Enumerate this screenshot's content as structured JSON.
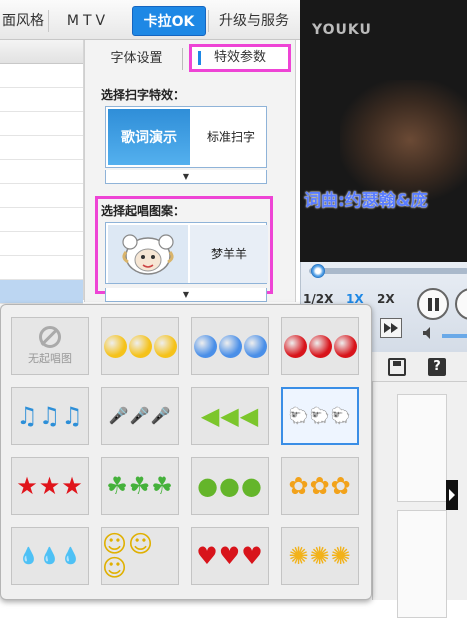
{
  "tabs": [
    {
      "label": "面风格"
    },
    {
      "label": "MTV"
    },
    {
      "label": "卡拉OK",
      "active": true
    },
    {
      "label": "升级与服务"
    }
  ],
  "settings": {
    "subtabs": [
      {
        "label": "字体设置"
      },
      {
        "label": "特效参数",
        "active": true
      }
    ],
    "scroll_effect_title": "选择扫字特效：",
    "scroll_effect_thumb": "歌词演示",
    "scroll_effect_value": "标准扫字",
    "start_pattern_title": "选择起唱图案：",
    "start_pattern_value": "梦羊羊"
  },
  "video": {
    "logo": "YOUKU",
    "lyric": "词曲:约瑟翰&庞"
  },
  "player": {
    "speeds": [
      "1/2X",
      "1X",
      "2X"
    ],
    "active_speed": "1X"
  },
  "pattern_grid": {
    "none_label": "无起唱图",
    "selected_index": 7,
    "items": [
      {
        "name": "none"
      },
      {
        "name": "yellow-dots",
        "color": "#f5c21a"
      },
      {
        "name": "blue-dots",
        "color": "#4a8fe8"
      },
      {
        "name": "red-dots",
        "color": "#d8141b"
      },
      {
        "name": "music-notes",
        "glyph": "♫♫♫",
        "color": "#2d8fd8"
      },
      {
        "name": "microphones",
        "glyph": "🎤🎤🎤",
        "color": "#f5c21a"
      },
      {
        "name": "green-arrows",
        "glyph": "◀◀◀",
        "color": "#7cc62c"
      },
      {
        "name": "sheep-heads",
        "glyph": "🐑🐑🐑",
        "color": "#999999"
      },
      {
        "name": "red-stars",
        "glyph": "★★★",
        "color": "#e0141b"
      },
      {
        "name": "clovers",
        "glyph": "☘☘☘",
        "color": "#45b13b"
      },
      {
        "name": "green-apples",
        "glyph": "●●●",
        "color": "#64b52a"
      },
      {
        "name": "orange-flowers",
        "glyph": "✿✿✿",
        "color": "#f2a21a"
      },
      {
        "name": "water-drops",
        "glyph": "💧💧💧",
        "color": "#5bb3e8"
      },
      {
        "name": "smileys",
        "glyph": "☺☺☺",
        "color": "#e0b000"
      },
      {
        "name": "red-hearts",
        "glyph": "♥♥♥",
        "color": "#d8141b"
      },
      {
        "name": "suns",
        "glyph": "✺✺✺",
        "color": "#f2b21a"
      }
    ]
  }
}
